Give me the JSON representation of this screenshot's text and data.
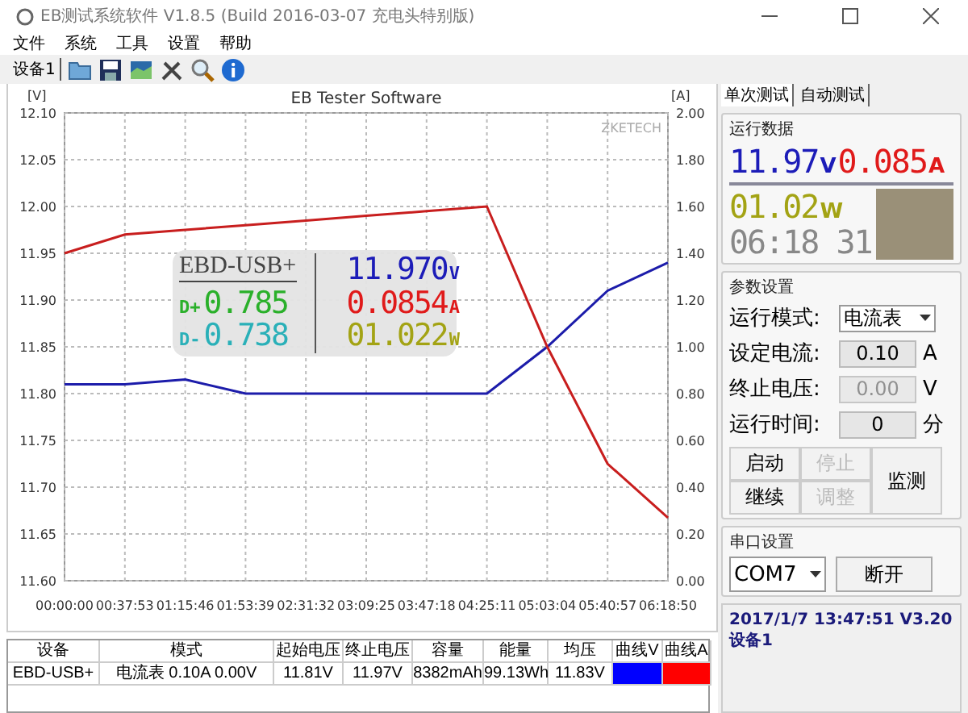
{
  "window": {
    "title": "EB测试系统软件 V1.8.5 (Build 2016-03-07 充电头特别版)"
  },
  "menu": [
    "文件",
    "系统",
    "工具",
    "设置",
    "帮助"
  ],
  "toolbar": {
    "device_label": "设备1"
  },
  "chart": {
    "brand": "ZKETECH",
    "overlay": {
      "device": "EBD-USB+",
      "voltage": "11.970",
      "voltage_unit": "V",
      "dplus_label": "D+",
      "dplus": "0.785",
      "current": "0.0854",
      "current_unit": "A",
      "dminus_label": "D-",
      "dminus": "0.738",
      "power": "01.022",
      "power_unit": "W"
    },
    "chart_data": {
      "type": "line",
      "title": "EB Tester Software",
      "categories": [
        "00:00:00",
        "00:37:53",
        "01:15:46",
        "01:53:39",
        "02:31:32",
        "03:09:25",
        "03:47:18",
        "04:25:11",
        "05:03:04",
        "05:40:57",
        "06:18:50"
      ],
      "ylabel": "[V]",
      "y2label": "[A]",
      "grid": true,
      "ylim": [
        11.6,
        12.1
      ],
      "yticks": [
        {
          "value": 11.6,
          "label": "11.60"
        },
        {
          "value": 11.65,
          "label": "11.65"
        },
        {
          "value": 11.7,
          "label": "11.70"
        },
        {
          "value": 11.75,
          "label": "11.75"
        },
        {
          "value": 11.8,
          "label": "11.80"
        },
        {
          "value": 11.85,
          "label": "11.85"
        },
        {
          "value": 11.9,
          "label": "11.90"
        },
        {
          "value": 11.95,
          "label": "11.95"
        },
        {
          "value": 12.0,
          "label": "12.00"
        },
        {
          "value": 12.05,
          "label": "12.05"
        },
        {
          "value": 12.1,
          "label": "12.10"
        }
      ],
      "y2lim": [
        0,
        2
      ],
      "y2ticks": [
        {
          "value": 0,
          "label": "0.00"
        },
        {
          "value": 0.2,
          "label": "0.20"
        },
        {
          "value": 0.4,
          "label": "0.40"
        },
        {
          "value": 0.6,
          "label": "0.60"
        },
        {
          "value": 0.8,
          "label": "0.80"
        },
        {
          "value": 1.0,
          "label": "1.00"
        },
        {
          "value": 1.2,
          "label": "1.20"
        },
        {
          "value": 1.4,
          "label": "1.40"
        },
        {
          "value": 1.6,
          "label": "1.60"
        },
        {
          "value": 1.8,
          "label": "1.80"
        },
        {
          "value": 2.0,
          "label": "2.00"
        }
      ],
      "series": [
        {
          "color": "#1c1caa",
          "values": [
            11.81,
            11.81,
            11.815,
            11.8,
            11.8,
            11.8,
            11.8,
            11.8,
            11.85,
            11.91,
            11.94
          ]
        },
        {
          "color": "#c81e1e",
          "axis": "y2",
          "values": [
            1.4,
            1.48,
            1.5,
            1.52,
            1.54,
            1.56,
            1.58,
            1.6,
            1.0,
            0.5,
            0.27
          ]
        }
      ]
    }
  },
  "right_panel": {
    "tabs": [
      {
        "label": "单次测试",
        "selected": true
      },
      {
        "label": "自动测试",
        "selected": false
      }
    ],
    "run_data": {
      "title": "运行数据",
      "voltage": "11.97",
      "voltage_unit": "V",
      "current": "0.085",
      "current_unit": "A",
      "power": "01.02",
      "power_unit": "W",
      "time": "06:18 31"
    },
    "params": {
      "title": "参数设置",
      "fields": [
        {
          "label": "运行模式:",
          "kind": "select",
          "value": "电流表",
          "disabled": false
        },
        {
          "label": "设定电流:",
          "kind": "input",
          "value": "0.10",
          "unit": "A",
          "disabled": false
        },
        {
          "label": "终止电压:",
          "kind": "input",
          "value": "0.00",
          "unit": "V",
          "disabled": true
        },
        {
          "label": "运行时间:",
          "kind": "input",
          "value": "0",
          "unit": "分",
          "disabled": false
        }
      ],
      "buttons": [
        {
          "label": "启动",
          "disabled": false,
          "tall": false
        },
        {
          "label": "停止",
          "disabled": true,
          "tall": false
        },
        {
          "label": "监测",
          "disabled": false,
          "tall": true
        },
        {
          "label": "继续",
          "disabled": false,
          "tall": false
        },
        {
          "label": "调整",
          "disabled": true,
          "tall": false
        }
      ]
    },
    "serial": {
      "title": "串口设置",
      "port": "COM7",
      "button": "断开"
    },
    "status_lines": [
      "2017/1/7 13:47:51 V3.20",
      "设备1"
    ]
  },
  "table": {
    "columns": [
      "设备",
      "模式",
      "起始电压",
      "终止电压",
      "容量",
      "能量",
      "均压",
      "曲线V",
      "曲线A"
    ],
    "rows": [
      {
        "cells": [
          "EBD-USB+",
          "电流表 0.10A 0.00V",
          "11.81V",
          "11.97V",
          "8382mAh",
          "99.13Wh",
          "11.83V"
        ],
        "swatches": [
          {
            "color": "#0000ff"
          },
          {
            "color": "#ff0000"
          }
        ]
      }
    ]
  }
}
